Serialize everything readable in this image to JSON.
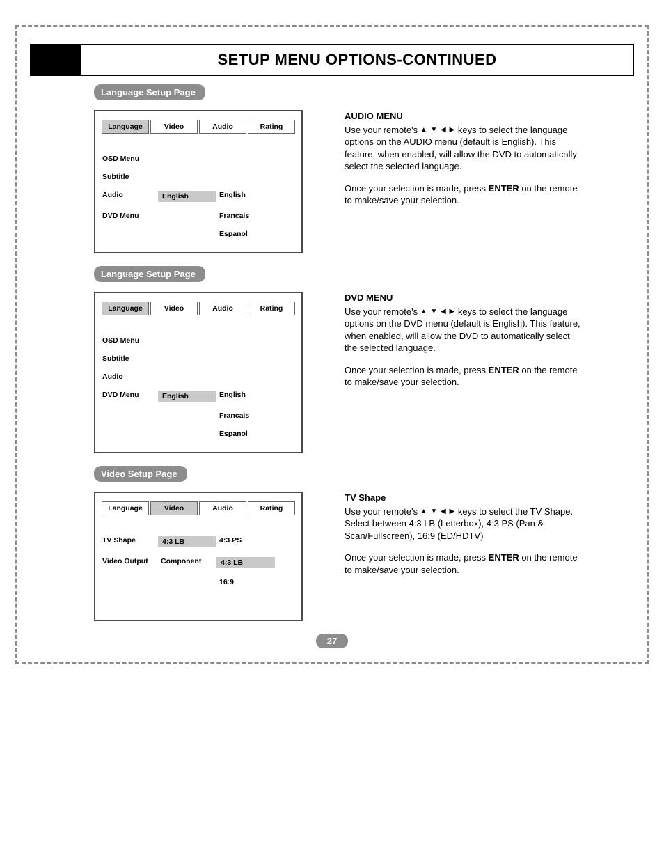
{
  "title": "SETUP MENU OPTIONS-CONTINUED",
  "tabs": {
    "language": "Language",
    "video": "Video",
    "audio": "Audio",
    "rating": "Rating"
  },
  "langMenuItems": {
    "osd": "OSD Menu",
    "subtitle": "Subtitle",
    "audio": "Audio",
    "dvd": "DVD Menu"
  },
  "langValue": "English",
  "langOptions": {
    "en": "English",
    "fr": "Francais",
    "es": "Espanol"
  },
  "section1": {
    "tab": "Language Setup Page",
    "heading": "AUDIO MENU",
    "p1a": "Use your remote's ",
    "p1b": " keys to select the language options on the AUDIO menu (default is English). This feature, when enabled, will allow the DVD  to automatically select the selected language.",
    "p2a": "Once your selection is made, press ",
    "p2b": "ENTER",
    "p2c": " on the remote to make/save your selection."
  },
  "section2": {
    "tab": "Language Setup Page",
    "heading": "DVD MENU",
    "p1a": "Use your remote's ",
    "p1b": " keys to select the language options on the DVD menu (default is English). This feature, when enabled, will allow the DVD  to automatically select the selected language.",
    "p2a": "Once your selection is made, press ",
    "p2b": "ENTER",
    "p2c": " on the remote to make/save your selection."
  },
  "section3": {
    "tab": "Video Setup Page",
    "heading": "TV Shape",
    "menuItems": {
      "tvshape": "TV Shape",
      "videoout": "Video Output"
    },
    "vals": {
      "tvVal": "4:3 LB",
      "outVal": "Component",
      "o1": "4:3 PS",
      "o2": "4:3 LB",
      "o3": "16:9"
    },
    "p1a": "Use your remote's ",
    "p1b": " keys to select the TV Shape. Select between 4:3 LB (Letterbox), 4:3 PS (Pan & Scan/Fullscreen), 16:9 (ED/HDTV)",
    "p2a": "Once your selection is made, press ",
    "p2b": "ENTER",
    "p2c": " on the remote to make/save your selection."
  },
  "pageNumber": "27"
}
